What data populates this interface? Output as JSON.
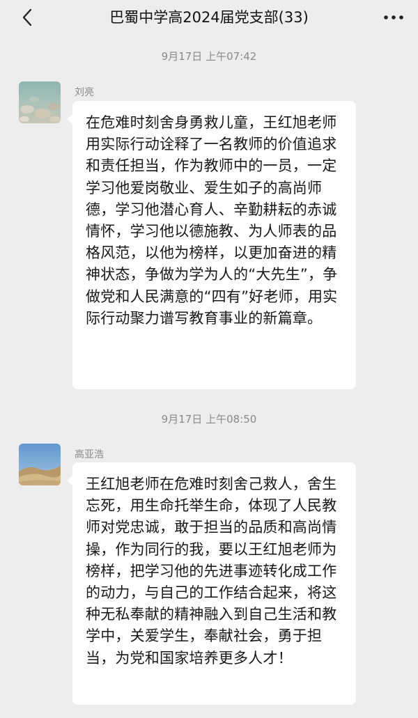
{
  "header": {
    "title": "巴蜀中学高2024届党支部(33)",
    "back_icon": "chevron-left-icon",
    "more_icon": "more-dots-icon"
  },
  "messages": [
    {
      "timestamp": "9月17日 上午07:42",
      "sender": "刘亮",
      "avatar": "avatar-rocks-photo",
      "text": "在危难时刻舍身勇救儿童，王红旭老师用实际行动诠释了一名教师的价值追求和责任担当，作为教师中的一员，一定学习他爱岗敬业、爱生如子的高尚师德，学习他潜心育人、辛勤耕耘的赤诚情怀，学习他以德施教、为人师表的品格风范，以他为榜样，以更加奋进的精神状态，争做为学为人的“大先生”，争做党和人民满意的“四有”好老师，用实际行动聚力谱写教育事业的新篇章。"
    },
    {
      "timestamp": "9月17日 上午08:50",
      "sender": "高亚浩",
      "avatar": "avatar-desert-photo",
      "text": "王红旭老师在危难时刻舍己救人，舍生忘死，用生命托举生命，体现了人民教师对党忠诚，敢于担当的品质和高尚情操，作为同行的我，要以王红旭老师为榜样，把学习他的先进事迹转化成工作的动力，与自己的工作结合起来，将这种无私奉献的精神融入到自己生活和教学中，关爱学生，奉献社会，勇于担当，为党和国家培养更多人才！"
    }
  ]
}
